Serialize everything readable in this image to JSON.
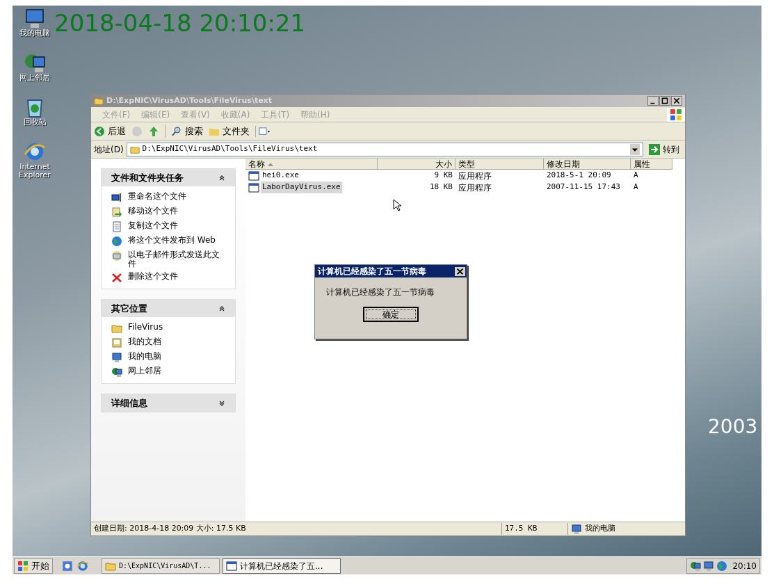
{
  "desktop": {
    "clock_overlay": "2018-04-18 20:10:21",
    "wallpaper_text": "2003",
    "icons": [
      {
        "label": "我的电脑",
        "kind": "computer"
      },
      {
        "label": "网上邻居",
        "kind": "network"
      },
      {
        "label": "回收站",
        "kind": "recycle"
      },
      {
        "label": "Internet Explorer",
        "kind": "ie"
      }
    ]
  },
  "explorer": {
    "title": "D:\\ExpNIC\\VirusAD\\Tools\\FileVirus\\text",
    "menu": [
      {
        "label": "文件(F)",
        "disabled": true
      },
      {
        "label": "编辑(E)",
        "disabled": true
      },
      {
        "label": "查看(V)",
        "disabled": true
      },
      {
        "label": "收藏(A)",
        "disabled": true
      },
      {
        "label": "工具(T)",
        "disabled": true
      },
      {
        "label": "帮助(H)",
        "disabled": true
      }
    ],
    "toolbar": {
      "back": "后退",
      "search": "搜索",
      "folders": "文件夹"
    },
    "address": {
      "label": "地址(D)",
      "value": "D:\\ExpNIC\\VirusAD\\Tools\\FileVirus\\text",
      "go": "转到"
    },
    "task_panels": [
      {
        "title": "文件和文件夹任务",
        "expanded": true,
        "items": [
          {
            "label": "重命名这个文件",
            "kind": "rename"
          },
          {
            "label": "移动这个文件",
            "kind": "move"
          },
          {
            "label": "复制这个文件",
            "kind": "copy"
          },
          {
            "label": "将这个文件发布到 Web",
            "kind": "web"
          },
          {
            "label": "以电子邮件形式发送此文件",
            "kind": "mail"
          },
          {
            "label": "删除这个文件",
            "kind": "delete"
          }
        ]
      },
      {
        "title": "其它位置",
        "expanded": true,
        "items": [
          {
            "label": "FileVirus",
            "kind": "folder"
          },
          {
            "label": "我的文档",
            "kind": "documents"
          },
          {
            "label": "我的电脑",
            "kind": "computer"
          },
          {
            "label": "网上邻居",
            "kind": "network"
          }
        ]
      },
      {
        "title": "详细信息",
        "expanded": false
      }
    ],
    "columns": [
      {
        "label": "名称",
        "sorted": true
      },
      {
        "label": "大小",
        "sorted": false
      },
      {
        "label": "类型",
        "sorted": false
      },
      {
        "label": "修改日期",
        "sorted": false
      },
      {
        "label": "属性",
        "sorted": false
      }
    ],
    "files": [
      {
        "name": "hei0.exe",
        "size": "9 KB",
        "type": "应用程序",
        "modified": "2018-5-1 20:09",
        "attributes": "A",
        "selected": false
      },
      {
        "name": "LaborDayVirus.exe",
        "size": "18 KB",
        "type": "应用程序",
        "modified": "2007-11-15 17:43",
        "attributes": "A",
        "selected": true
      }
    ],
    "status_bar": {
      "details": "创建日期: 2018-4-18 20:09 大小: 17.5 KB",
      "size": "17.5 KB",
      "zone": "我的电脑"
    }
  },
  "dialog": {
    "title": "计算机已经感染了五一节病毒",
    "message": "计算机已经感染了五一节病毒",
    "button": "确定"
  },
  "taskbar": {
    "start": "开始",
    "tasks": [
      {
        "label": "D:\\ExpNIC\\VirusAD\\T...",
        "kind": "folder",
        "selected": false
      },
      {
        "label": "计算机已经感染了五...",
        "kind": "window",
        "selected": true
      }
    ],
    "clock": "20:10"
  }
}
